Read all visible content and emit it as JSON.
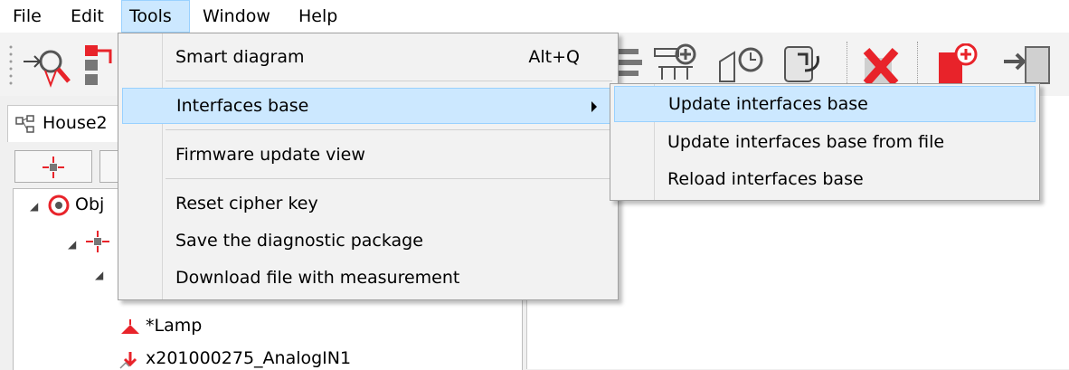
{
  "menubar": {
    "items": [
      {
        "label": "File"
      },
      {
        "label": "Edit"
      },
      {
        "label": "Tools"
      },
      {
        "label": "Window"
      },
      {
        "label": "Help"
      }
    ]
  },
  "toolbar": {
    "icons": [
      "search-cursor-icon",
      "connector-icon",
      "list-tree-icon",
      "add-node-icon",
      "cube-refresh-icon",
      "phone-rotate-icon",
      "delete-red-x-icon",
      "add-document-red-icon",
      "import-device-icon"
    ]
  },
  "left_panel": {
    "tab_label": "House2"
  },
  "tree": {
    "items": [
      {
        "label": "Obj"
      },
      {
        "label": "*Lamp"
      },
      {
        "label": "x201000275_AnalogIN1"
      }
    ]
  },
  "tools_menu": {
    "items": [
      {
        "label": "Smart diagram",
        "shortcut": "Alt+Q"
      },
      {
        "label": "Interfaces base"
      },
      {
        "label": "Firmware update view"
      },
      {
        "label": "Reset cipher key"
      },
      {
        "label": "Save the diagnostic package"
      },
      {
        "label": "Download file with measurement"
      }
    ]
  },
  "submenu": {
    "items": [
      {
        "label": "Update interfaces base"
      },
      {
        "label": "Update interfaces base from file"
      },
      {
        "label": "Reload interfaces base"
      }
    ]
  },
  "colors": {
    "highlight": "#cce8ff",
    "highlight_border": "#99d1ff",
    "accent_red": "#e8232a"
  }
}
